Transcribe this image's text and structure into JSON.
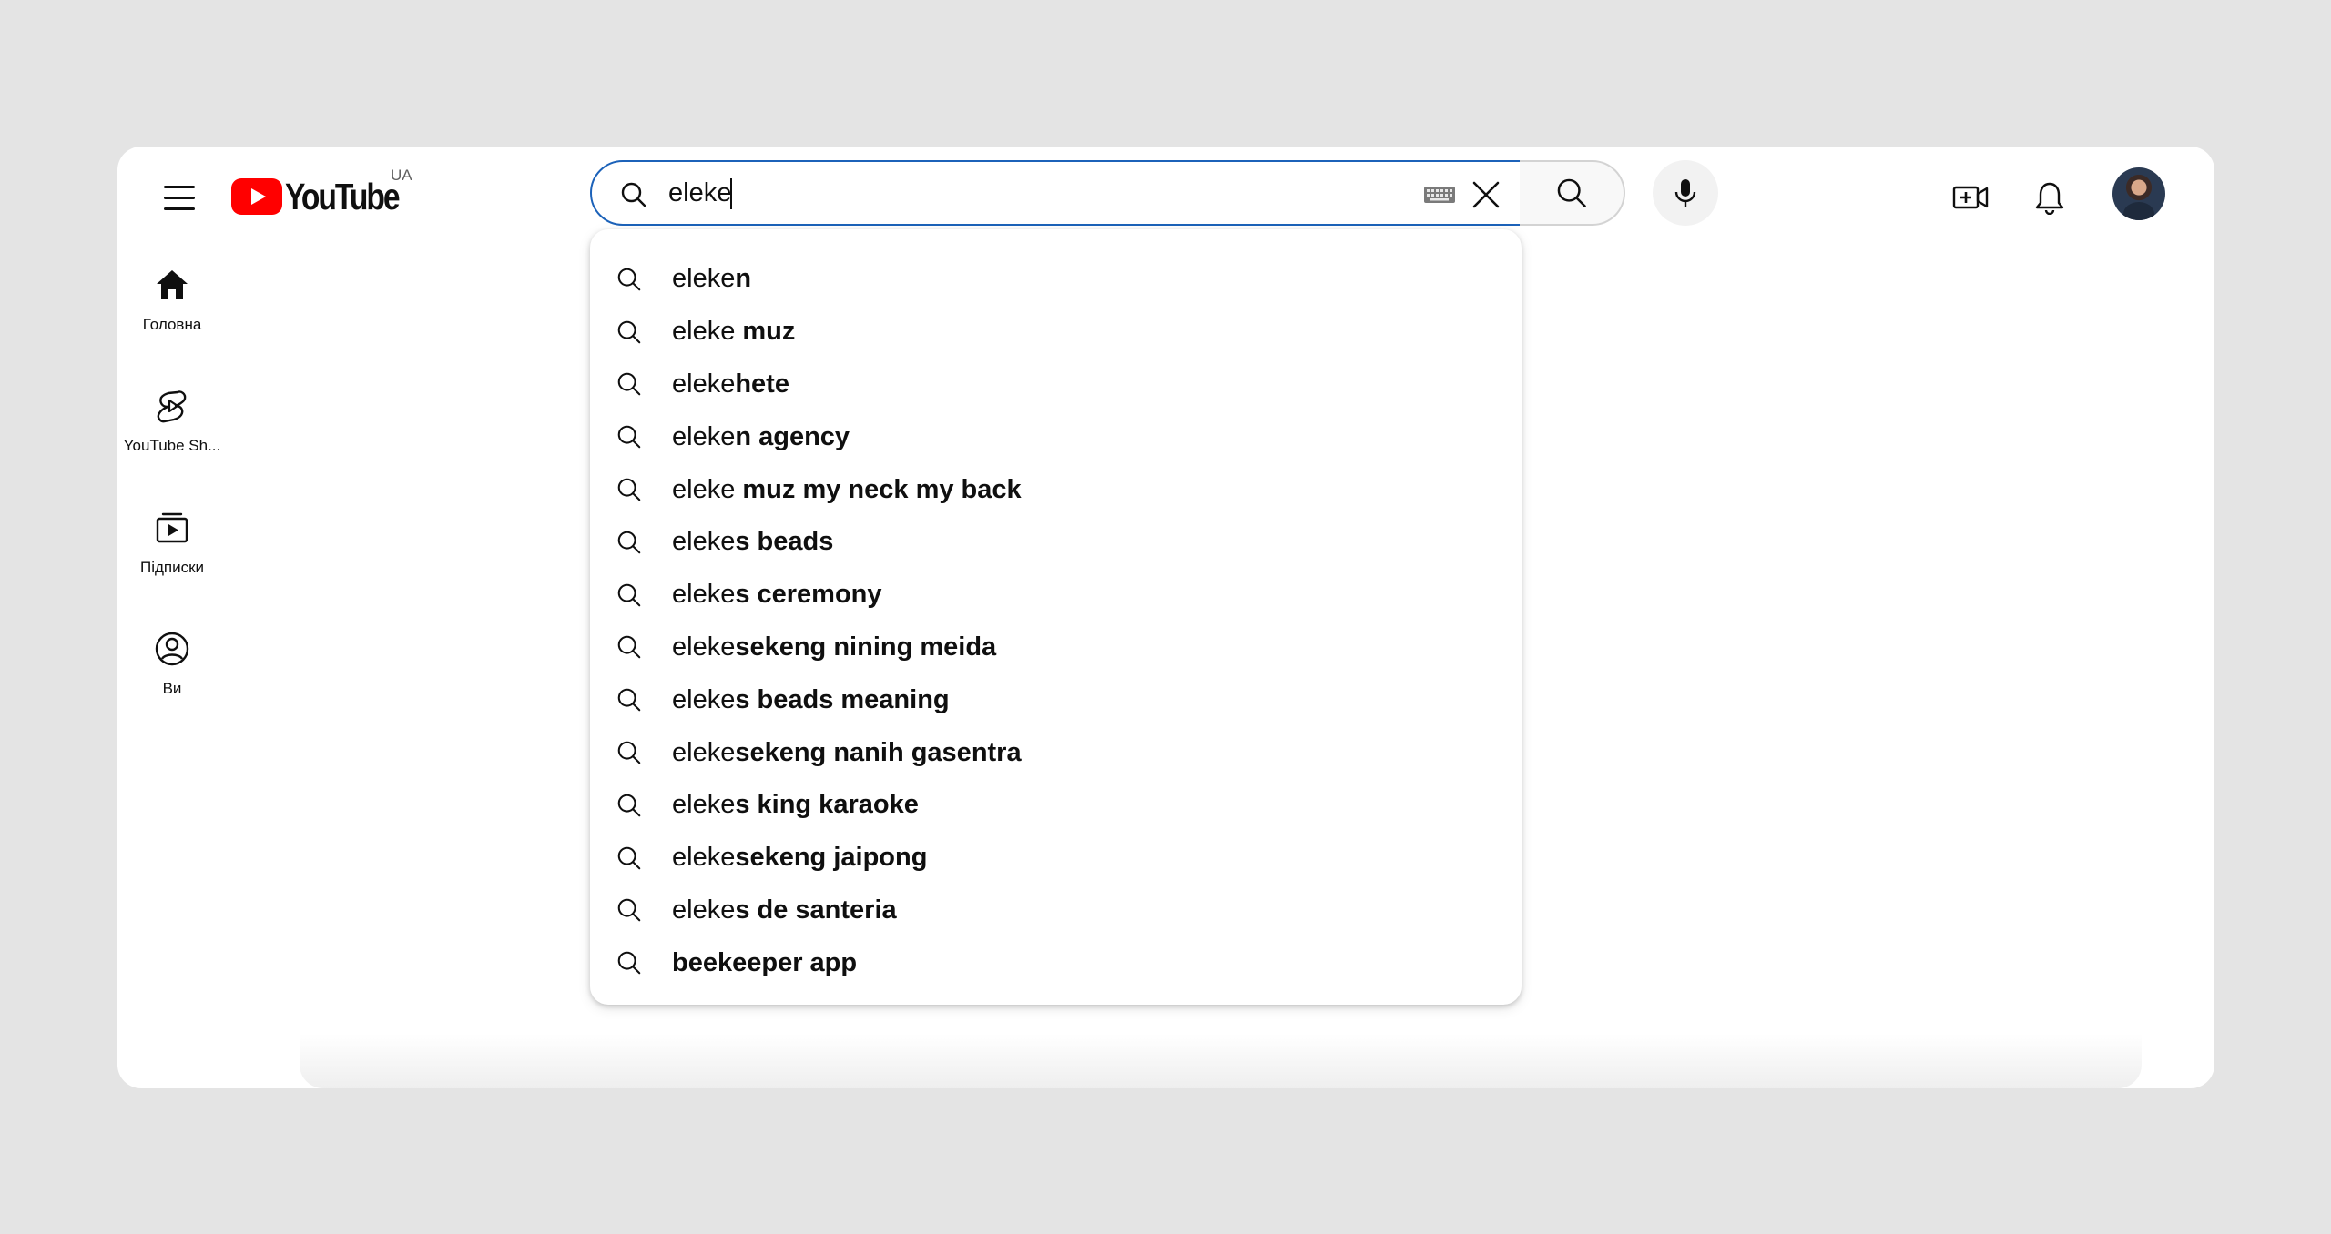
{
  "header": {
    "logo_text": "YouTube",
    "country_code": "UA",
    "search": {
      "value": "eleke",
      "typed_prefix": "eleke"
    }
  },
  "sidebar": {
    "items": [
      {
        "label": "Головна",
        "icon": "home-icon"
      },
      {
        "label": "YouTube Sh...",
        "icon": "shorts-icon"
      },
      {
        "label": "Підписки",
        "icon": "subscriptions-icon"
      },
      {
        "label": "Ви",
        "icon": "you-icon"
      }
    ]
  },
  "suggestions": [
    {
      "prefix": "eleke",
      "rest": "n"
    },
    {
      "prefix": "eleke",
      "rest": " muz"
    },
    {
      "prefix": "eleke",
      "rest": "hete"
    },
    {
      "prefix": "eleke",
      "rest": "n agency"
    },
    {
      "prefix": "eleke",
      "rest": " muz my neck my back"
    },
    {
      "prefix": "eleke",
      "rest": "s beads"
    },
    {
      "prefix": "eleke",
      "rest": "s ceremony"
    },
    {
      "prefix": "eleke",
      "rest": "sekeng nining meida"
    },
    {
      "prefix": "eleke",
      "rest": "s beads meaning"
    },
    {
      "prefix": "eleke",
      "rest": "sekeng nanih gasentra"
    },
    {
      "prefix": "eleke",
      "rest": "s king karaoke"
    },
    {
      "prefix": "eleke",
      "rest": "sekeng jaipong"
    },
    {
      "prefix": "eleke",
      "rest": "s de santeria"
    },
    {
      "prefix": "",
      "rest": "beekeeper app"
    }
  ],
  "colors": {
    "brand_red": "#ff0000",
    "focus_blue": "#1c62b9",
    "text": "#0f0f0f",
    "page_bg": "#e4e4e4"
  }
}
